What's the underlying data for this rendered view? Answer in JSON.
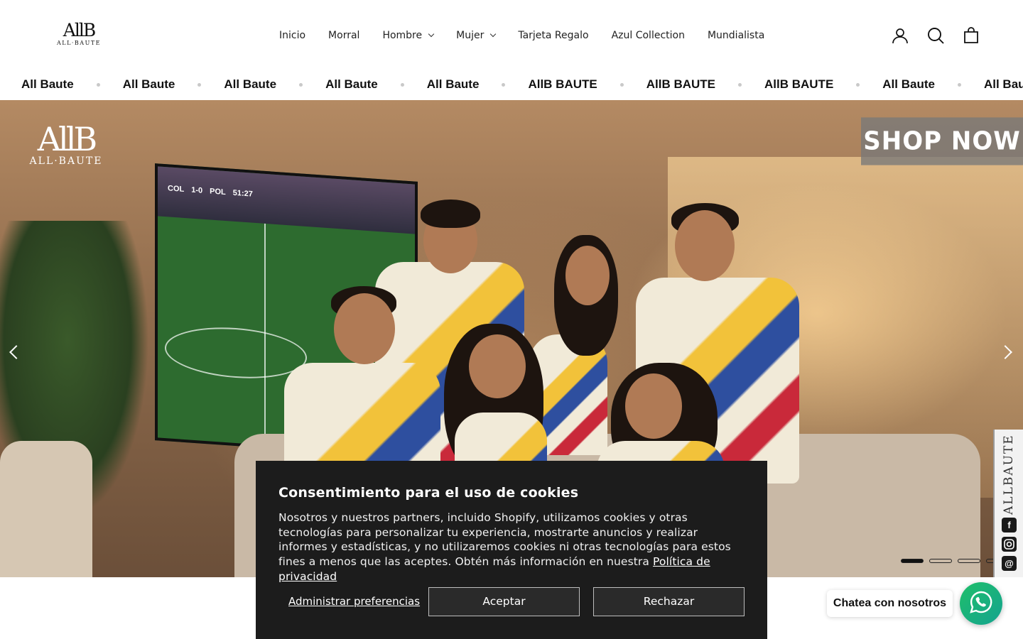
{
  "header": {
    "logo_mark": "AllB",
    "logo_word": "ALL·BAUTE",
    "nav": [
      {
        "label": "Inicio",
        "has_dropdown": false
      },
      {
        "label": "Morral",
        "has_dropdown": false
      },
      {
        "label": "Hombre",
        "has_dropdown": true
      },
      {
        "label": "Mujer",
        "has_dropdown": true
      },
      {
        "label": "Tarjeta Regalo",
        "has_dropdown": false
      },
      {
        "label": "Azul Collection",
        "has_dropdown": false
      },
      {
        "label": "Mundialista",
        "has_dropdown": false
      }
    ],
    "icons": [
      "account-icon",
      "search-icon",
      "cart-icon"
    ]
  },
  "marquee": {
    "items": [
      "All Baute",
      "All Baute",
      "All Baute",
      "All Baute",
      "All Baute",
      "AllB BAUTE",
      "AllB BAUTE",
      "AllB BAUTE",
      "All Baute",
      "All Baut"
    ]
  },
  "hero": {
    "logo_mark": "AllB",
    "logo_word": "ALL·BAUTE",
    "cta": "SHOP NOW",
    "tv_score": {
      "home": "COL",
      "score": "1-0",
      "away": "POL",
      "time": "51:27"
    },
    "slides_total": 4,
    "active_slide": 1,
    "side_badge_text": "ALLBAUTE",
    "side_icons": [
      "facebook-icon",
      "instagram-icon",
      "threads-icon"
    ]
  },
  "cookie": {
    "title": "Consentimiento para el uso de cookies",
    "body": "Nosotros y nuestros partners, incluido Shopify, utilizamos cookies y otras tecnologías para personalizar tu experiencia, mostrarte anuncios y realizar informes y estadísticas, y no utilizaremos cookies ni otras tecnologías para estos fines a menos que las aceptes. Obtén más información en nuestra",
    "link": "Política de privacidad",
    "manage": "Administrar preferencias",
    "accept": "Aceptar",
    "reject": "Rechazar"
  },
  "chat": {
    "label": "Chatea con nosotros",
    "icon": "whatsapp-icon"
  },
  "colors": {
    "cookie_bg": "#1c1c1c",
    "chat_green": "#1fbf6a",
    "text": "#1a1a1a"
  }
}
